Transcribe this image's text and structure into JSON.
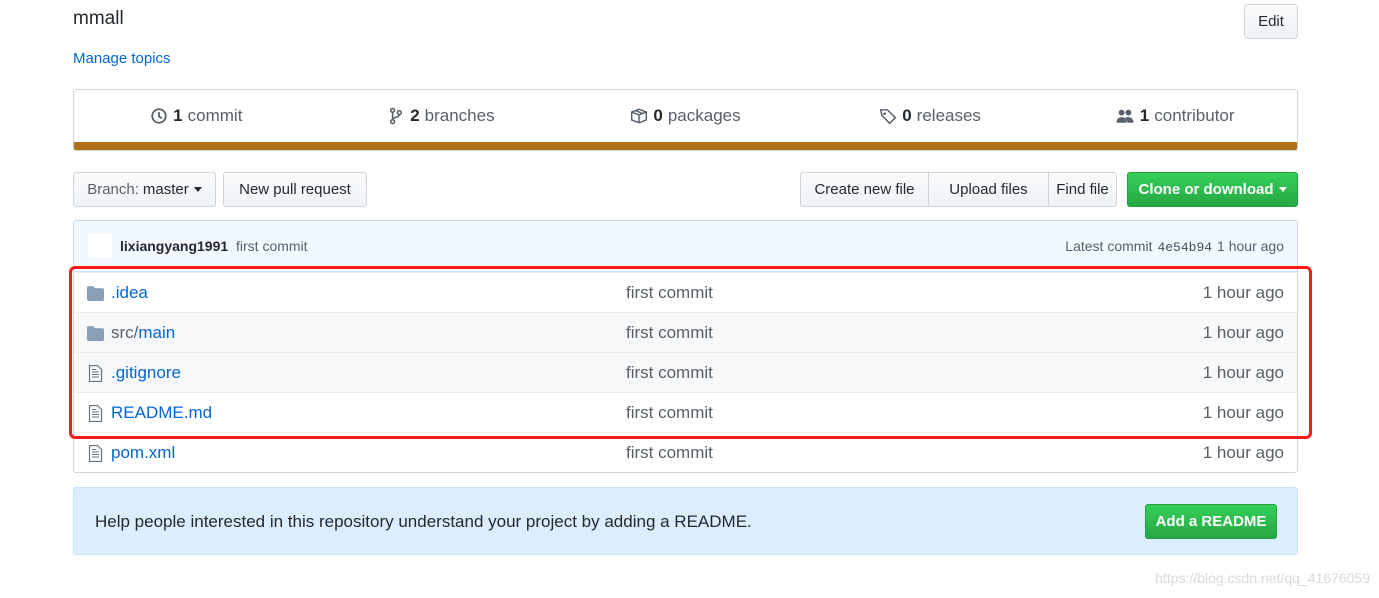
{
  "repo": {
    "description": "mmall",
    "manage_topics": "Manage topics",
    "edit_label": "Edit"
  },
  "summary": {
    "commits": {
      "count": "1",
      "label": "commit",
      "icon": "history-icon"
    },
    "branches": {
      "count": "2",
      "label": "branches",
      "icon": "branch-icon"
    },
    "packages": {
      "count": "0",
      "label": "packages",
      "icon": "package-icon"
    },
    "releases": {
      "count": "0",
      "label": "releases",
      "icon": "tag-icon"
    },
    "contributors": {
      "count": "1",
      "label": "contributor",
      "icon": "people-icon"
    },
    "language_color": "#b07219"
  },
  "toolbar": {
    "branch_prefix": "Branch:",
    "branch_name": "master",
    "new_pull_request": "New pull request",
    "create_new_file": "Create new file",
    "upload_files": "Upload files",
    "find_file": "Find file",
    "clone_or_download": "Clone or download"
  },
  "commit_tease": {
    "author": "lixiangyang1991",
    "message": "first commit",
    "latest_label": "Latest commit",
    "sha": "4e54b94",
    "age": "1 hour ago"
  },
  "files": [
    {
      "type": "folder",
      "prefix": "",
      "name": ".idea",
      "message": "first commit",
      "age": "1 hour ago"
    },
    {
      "type": "folder",
      "prefix": "src/",
      "name": "main",
      "message": "first commit",
      "age": "1 hour ago"
    },
    {
      "type": "file",
      "prefix": "",
      "name": ".gitignore",
      "message": "first commit",
      "age": "1 hour ago"
    },
    {
      "type": "file",
      "prefix": "",
      "name": "README.md",
      "message": "first commit",
      "age": "1 hour ago"
    },
    {
      "type": "file",
      "prefix": "",
      "name": "pom.xml",
      "message": "first commit",
      "age": "1 hour ago"
    }
  ],
  "readme_prompt": {
    "text": "Help people interested in this repository understand your project by adding a README.",
    "button": "Add a README"
  },
  "watermark": "https://blog.csdn.net/qq_41676059",
  "colors": {
    "link": "#0366d6",
    "primary_green": "#28a745",
    "highlight": "#ff1a1a"
  }
}
